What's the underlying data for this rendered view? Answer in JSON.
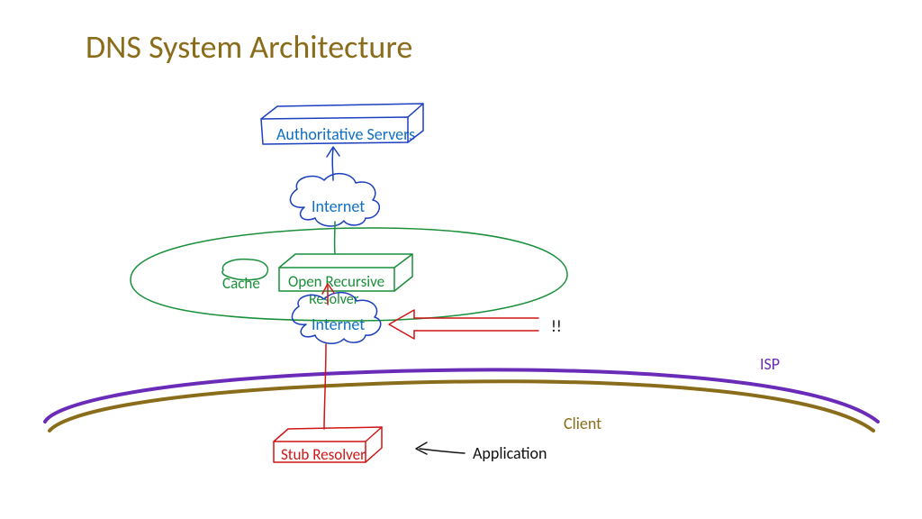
{
  "title": "DNS System Architecture",
  "nodes": {
    "authoritative": "Authoritative Servers",
    "internet_upper": "Internet",
    "cache": "Cache",
    "open_recursive": "Open Recursive",
    "resolver": "Resolver",
    "internet_lower": "Internet",
    "stub_resolver": "Stub Resolver"
  },
  "annotations": {
    "alert": "!!",
    "isp": "ISP",
    "client": "Client",
    "application": "Application"
  },
  "colors": {
    "title": "#8a6d1a",
    "blue": "#1a3fbf",
    "blue_text": "#0f6fc5",
    "green": "#1a8f3a",
    "red": "#d01515",
    "olive": "#8a6d1a",
    "purple": "#6a2bb9",
    "black": "#111111"
  }
}
